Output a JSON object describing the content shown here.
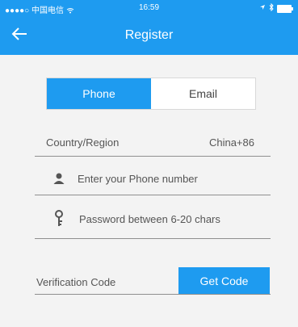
{
  "status_bar": {
    "signal_carrier": "●●●●○ 中国电信 ",
    "wifi_icon": "wifi-icon",
    "time": "16:59",
    "location_icon": "location-arrow-icon",
    "bluetooth_icon": "bluetooth-icon",
    "battery_icon": "battery-icon",
    "battery_level": 1.0
  },
  "header": {
    "back_icon": "back-arrow-icon",
    "title": "Register",
    "color": "#1e9bf0"
  },
  "tabs": [
    {
      "label": "Phone",
      "active": true
    },
    {
      "label": "Email",
      "active": false
    }
  ],
  "form": {
    "country_label": "Country/Region",
    "country_value": "China+86",
    "phone_icon": "user-icon",
    "phone_placeholder": "Enter your Phone number",
    "password_icon": "key-icon",
    "password_placeholder": "Password between 6-20 chars",
    "verification_label": "Verification Code",
    "get_code_label": "Get Code"
  }
}
